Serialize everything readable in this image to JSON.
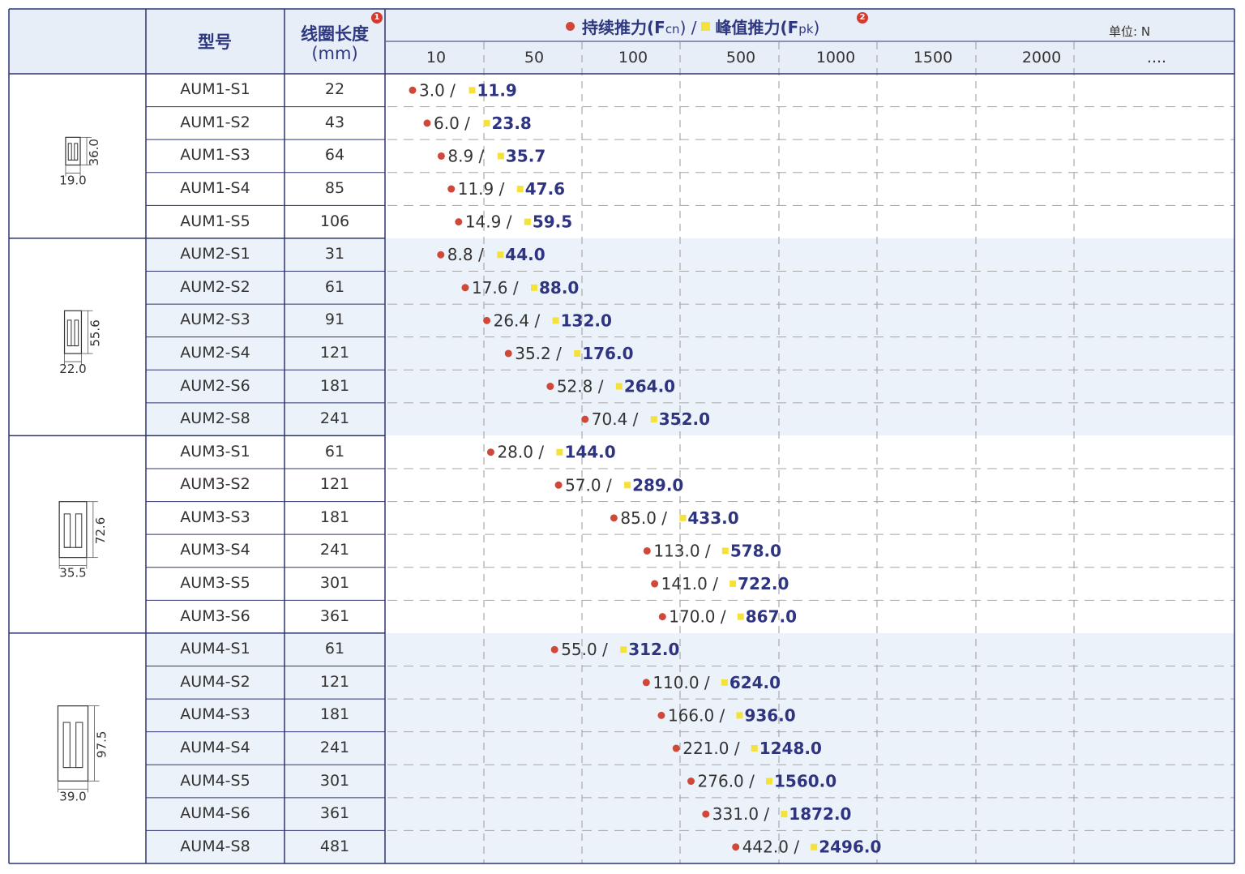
{
  "header": {
    "model_label": "型号",
    "coil_label_line1": "线圈长度",
    "coil_label_line2": "(mm)",
    "legend_continuous": "持续推力(F",
    "legend_continuous_sub": "cn",
    "legend_sep": ") /",
    "legend_peak": "峰值推力(F",
    "legend_peak_sub": "pk",
    "legend_close": ")",
    "unit": "单位: N",
    "badge1": "1",
    "badge2": "2"
  },
  "colors": {
    "continuous_marker": "#d0483a",
    "peak_marker": "#f4e23a",
    "peak_text": "#2e3480",
    "border": "#2e3470",
    "band": "#ecf2f9"
  },
  "groups": [
    {
      "dim_height": "36.0",
      "dim_width": "19.0"
    },
    {
      "dim_height": "55.6",
      "dim_width": "22.0"
    },
    {
      "dim_height": "72.6",
      "dim_width": "35.5"
    },
    {
      "dim_height": "97.5",
      "dim_width": "39.0"
    }
  ],
  "chart_data": {
    "type": "scatter",
    "x_axis_ticks": [
      "10",
      "50",
      "100",
      "500",
      "1000",
      "1500",
      "2000",
      "...."
    ],
    "series": [
      {
        "name": "持续推力(Fcn)",
        "marker": "dot"
      },
      {
        "name": "峰值推力(Fpk)",
        "marker": "square"
      }
    ],
    "rows": [
      {
        "model": "AUM1-S1",
        "coil": "22",
        "fcn": "3.0",
        "fpk": "11.9",
        "group": 0
      },
      {
        "model": "AUM1-S2",
        "coil": "43",
        "fcn": "6.0",
        "fpk": "23.8",
        "group": 0
      },
      {
        "model": "AUM1-S3",
        "coil": "64",
        "fcn": "8.9",
        "fpk": "35.7",
        "group": 0
      },
      {
        "model": "AUM1-S4",
        "coil": "85",
        "fcn": "11.9",
        "fpk": "47.6",
        "group": 0
      },
      {
        "model": "AUM1-S5",
        "coil": "106",
        "fcn": "14.9",
        "fpk": "59.5",
        "group": 0
      },
      {
        "model": "AUM2-S1",
        "coil": "31",
        "fcn": "8.8",
        "fpk": "44.0",
        "group": 1
      },
      {
        "model": "AUM2-S2",
        "coil": "61",
        "fcn": "17.6",
        "fpk": "88.0",
        "group": 1
      },
      {
        "model": "AUM2-S3",
        "coil": "91",
        "fcn": "26.4",
        "fpk": "132.0",
        "group": 1
      },
      {
        "model": "AUM2-S4",
        "coil": "121",
        "fcn": "35.2",
        "fpk": "176.0",
        "group": 1
      },
      {
        "model": "AUM2-S6",
        "coil": "181",
        "fcn": "52.8",
        "fpk": "264.0",
        "group": 1
      },
      {
        "model": "AUM2-S8",
        "coil": "241",
        "fcn": "70.4",
        "fpk": "352.0",
        "group": 1
      },
      {
        "model": "AUM3-S1",
        "coil": "61",
        "fcn": "28.0",
        "fpk": "144.0",
        "group": 2
      },
      {
        "model": "AUM3-S2",
        "coil": "121",
        "fcn": "57.0",
        "fpk": "289.0",
        "group": 2
      },
      {
        "model": "AUM3-S3",
        "coil": "181",
        "fcn": "85.0",
        "fpk": "433.0",
        "group": 2
      },
      {
        "model": "AUM3-S4",
        "coil": "241",
        "fcn": "113.0",
        "fpk": "578.0",
        "group": 2
      },
      {
        "model": "AUM3-S5",
        "coil": "301",
        "fcn": "141.0",
        "fpk": "722.0",
        "group": 2
      },
      {
        "model": "AUM3-S6",
        "coil": "361",
        "fcn": "170.0",
        "fpk": "867.0",
        "group": 2
      },
      {
        "model": "AUM4-S1",
        "coil": "61",
        "fcn": "55.0",
        "fpk": "312.0",
        "group": 3
      },
      {
        "model": "AUM4-S2",
        "coil": "121",
        "fcn": "110.0",
        "fpk": "624.0",
        "group": 3
      },
      {
        "model": "AUM4-S3",
        "coil": "181",
        "fcn": "166.0",
        "fpk": "936.0",
        "group": 3
      },
      {
        "model": "AUM4-S4",
        "coil": "241",
        "fcn": "221.0",
        "fpk": "1248.0",
        "group": 3
      },
      {
        "model": "AUM4-S5",
        "coil": "301",
        "fcn": "276.0",
        "fpk": "1560.0",
        "group": 3
      },
      {
        "model": "AUM4-S6",
        "coil": "361",
        "fcn": "331.0",
        "fpk": "1872.0",
        "group": 3
      },
      {
        "model": "AUM4-S8",
        "coil": "481",
        "fcn": "442.0",
        "fpk": "2496.0",
        "group": 3
      }
    ]
  }
}
